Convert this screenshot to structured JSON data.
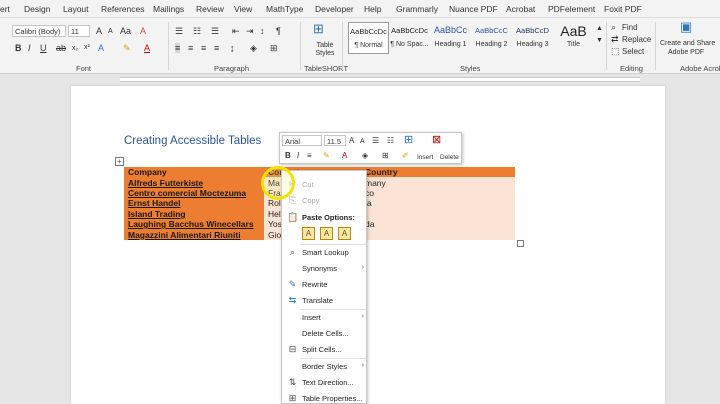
{
  "tabs": [
    "ert",
    "Design",
    "Layout",
    "References",
    "Mailings",
    "Review",
    "View",
    "MathType",
    "Developer",
    "Help",
    "Grammarly",
    "Nuance PDF",
    "Acrobat",
    "PDFelement",
    "Foxit PDF"
  ],
  "ribbon": {
    "font_name": "Calibri (Body)",
    "font_size": "11",
    "font_group": "Font",
    "paragraph_group": "Paragraph",
    "tableshort_group": "TableSHORT",
    "table_styles_label": "Table Styles",
    "styles_group": "Styles",
    "editing_group": "Editing",
    "adobe_group": "Adobe Acrobat",
    "styles": [
      {
        "sample": "AaBbCcDc",
        "name": "¶ Normal"
      },
      {
        "sample": "AaBbCcDc",
        "name": "¶ No Spac..."
      },
      {
        "sample": "AaBbCc",
        "name": "Heading 1"
      },
      {
        "sample": "AaBbCcC",
        "name": "Heading 2"
      },
      {
        "sample": "AaBbCcD",
        "name": "Heading 3"
      },
      {
        "sample": "AaB",
        "name": "Title"
      }
    ],
    "find": "Find",
    "replace": "Replace",
    "select": "Select",
    "create_share_1": "Create and Share",
    "create_share_2": "Adobe PDF"
  },
  "document": {
    "title": "Creating Accessible Tables",
    "headers": [
      "Company",
      "Contact",
      "Country"
    ],
    "rows": [
      {
        "company": "Alfreds Futterkiste",
        "contact": "Ma",
        "country": "many"
      },
      {
        "company": "Centro comercial Moctezuma",
        "contact": "Fra",
        "country": "co"
      },
      {
        "company": "Ernst Handel",
        "contact": "Rol",
        "country": "ia"
      },
      {
        "company": "Island Trading",
        "contact": "Hel",
        "country": ""
      },
      {
        "company": "Laughing Bacchus Winecellars",
        "contact": "Yos",
        "country": "da"
      },
      {
        "company": "Magazzini Alimentari Riuniti",
        "contact": "Gio",
        "country": ""
      }
    ]
  },
  "mini_toolbar": {
    "font": "Arial",
    "size": "11.5",
    "insert": "Insert",
    "delete": "Delete"
  },
  "context_menu": {
    "cut": "Cut",
    "copy": "Copy",
    "paste_options": "Paste Options:",
    "smart_lookup": "Smart Lookup",
    "synonyms": "Synonyms",
    "rewrite": "Rewrite",
    "translate": "Translate",
    "insert": "Insert",
    "delete_cells": "Delete Cells...",
    "split_cells": "Split Cells...",
    "border_styles": "Border Styles",
    "text_direction": "Text Direction...",
    "table_properties": "Table Properties..."
  },
  "colors": {
    "header_orange": "#ed7d31",
    "cell_peach": "#fbe4d5",
    "title_blue": "#2f5496",
    "highlight_yellow": "#f5e100"
  }
}
